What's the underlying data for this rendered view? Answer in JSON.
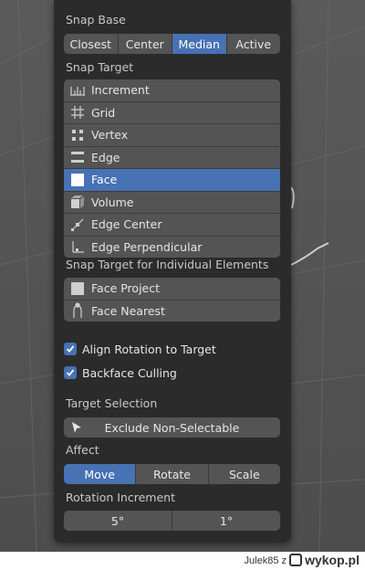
{
  "snap_base": {
    "label": "Snap Base",
    "options": [
      "Closest",
      "Center",
      "Median",
      "Active"
    ],
    "selected": "Median"
  },
  "snap_target": {
    "label": "Snap Target",
    "items": [
      {
        "label": "Increment",
        "icon": "increment-icon"
      },
      {
        "label": "Grid",
        "icon": "grid-icon"
      },
      {
        "label": "Vertex",
        "icon": "vertex-icon"
      },
      {
        "label": "Edge",
        "icon": "edge-icon"
      },
      {
        "label": "Face",
        "icon": "face-icon"
      },
      {
        "label": "Volume",
        "icon": "volume-icon"
      },
      {
        "label": "Edge Center",
        "icon": "edge-center-icon"
      },
      {
        "label": "Edge Perpendicular",
        "icon": "edge-perpendicular-icon"
      }
    ],
    "selected": "Face"
  },
  "individual": {
    "label": "Snap Target for Individual Elements",
    "items": [
      {
        "label": "Face Project",
        "icon": "face-project-icon"
      },
      {
        "label": "Face Nearest",
        "icon": "face-nearest-icon"
      }
    ]
  },
  "options": {
    "align_rotation": "Align Rotation to Target",
    "backface_culling": "Backface Culling"
  },
  "target_selection": {
    "label": "Target Selection",
    "button": "Exclude Non-Selectable"
  },
  "affect": {
    "label": "Affect",
    "options": [
      "Move",
      "Rotate",
      "Scale"
    ],
    "selected": "Move"
  },
  "rotation_increment": {
    "label": "Rotation Increment",
    "values": [
      "5°",
      "1°"
    ]
  },
  "footer": {
    "credit": "Julek85  z",
    "logo": "wykop.pl"
  },
  "colors": {
    "accent": "#4772b3",
    "panel": "#2b2b2b",
    "widget": "#545454"
  }
}
